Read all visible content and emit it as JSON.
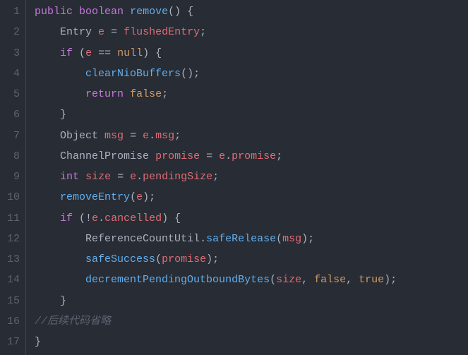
{
  "lines": [
    {
      "n": "1",
      "tokens": [
        {
          "t": "public",
          "c": "kw"
        },
        {
          "t": " ",
          "c": "plain"
        },
        {
          "t": "boolean",
          "c": "type"
        },
        {
          "t": " ",
          "c": "plain"
        },
        {
          "t": "remove",
          "c": "fn"
        },
        {
          "t": "() {",
          "c": "punct"
        }
      ]
    },
    {
      "n": "2",
      "tokens": [
        {
          "t": "    ",
          "c": "plain"
        },
        {
          "t": "Entry ",
          "c": "plain"
        },
        {
          "t": "e",
          "c": "id"
        },
        {
          "t": " = ",
          "c": "plain"
        },
        {
          "t": "flushedEntry",
          "c": "id"
        },
        {
          "t": ";",
          "c": "punct"
        }
      ]
    },
    {
      "n": "3",
      "tokens": [
        {
          "t": "    ",
          "c": "plain"
        },
        {
          "t": "if",
          "c": "kw"
        },
        {
          "t": " (",
          "c": "punct"
        },
        {
          "t": "e",
          "c": "id"
        },
        {
          "t": " == ",
          "c": "plain"
        },
        {
          "t": "null",
          "c": "lit"
        },
        {
          "t": ") {",
          "c": "punct"
        }
      ]
    },
    {
      "n": "4",
      "tokens": [
        {
          "t": "        ",
          "c": "plain"
        },
        {
          "t": "clearNioBuffers",
          "c": "fn"
        },
        {
          "t": "();",
          "c": "punct"
        }
      ]
    },
    {
      "n": "5",
      "tokens": [
        {
          "t": "        ",
          "c": "plain"
        },
        {
          "t": "return",
          "c": "kw"
        },
        {
          "t": " ",
          "c": "plain"
        },
        {
          "t": "false",
          "c": "bool"
        },
        {
          "t": ";",
          "c": "punct"
        }
      ]
    },
    {
      "n": "6",
      "tokens": [
        {
          "t": "    }",
          "c": "punct"
        }
      ]
    },
    {
      "n": "7",
      "tokens": [
        {
          "t": "    ",
          "c": "plain"
        },
        {
          "t": "Object ",
          "c": "plain"
        },
        {
          "t": "msg",
          "c": "id"
        },
        {
          "t": " = ",
          "c": "plain"
        },
        {
          "t": "e",
          "c": "id"
        },
        {
          "t": ".",
          "c": "punct"
        },
        {
          "t": "msg",
          "c": "id"
        },
        {
          "t": ";",
          "c": "punct"
        }
      ]
    },
    {
      "n": "8",
      "tokens": [
        {
          "t": "    ",
          "c": "plain"
        },
        {
          "t": "ChannelPromise ",
          "c": "plain"
        },
        {
          "t": "promise",
          "c": "id"
        },
        {
          "t": " = ",
          "c": "plain"
        },
        {
          "t": "e",
          "c": "id"
        },
        {
          "t": ".",
          "c": "punct"
        },
        {
          "t": "promise",
          "c": "id"
        },
        {
          "t": ";",
          "c": "punct"
        }
      ]
    },
    {
      "n": "9",
      "tokens": [
        {
          "t": "    ",
          "c": "plain"
        },
        {
          "t": "int",
          "c": "type"
        },
        {
          "t": " ",
          "c": "plain"
        },
        {
          "t": "size",
          "c": "id"
        },
        {
          "t": " = ",
          "c": "plain"
        },
        {
          "t": "e",
          "c": "id"
        },
        {
          "t": ".",
          "c": "punct"
        },
        {
          "t": "pendingSize",
          "c": "id"
        },
        {
          "t": ";",
          "c": "punct"
        }
      ]
    },
    {
      "n": "10",
      "tokens": [
        {
          "t": "    ",
          "c": "plain"
        },
        {
          "t": "removeEntry",
          "c": "fn"
        },
        {
          "t": "(",
          "c": "punct"
        },
        {
          "t": "e",
          "c": "id"
        },
        {
          "t": ");",
          "c": "punct"
        }
      ]
    },
    {
      "n": "11",
      "tokens": [
        {
          "t": "    ",
          "c": "plain"
        },
        {
          "t": "if",
          "c": "kw"
        },
        {
          "t": " (!",
          "c": "punct"
        },
        {
          "t": "e",
          "c": "id"
        },
        {
          "t": ".",
          "c": "punct"
        },
        {
          "t": "cancelled",
          "c": "id"
        },
        {
          "t": ") {",
          "c": "punct"
        }
      ]
    },
    {
      "n": "12",
      "tokens": [
        {
          "t": "        ",
          "c": "plain"
        },
        {
          "t": "ReferenceCountUtil",
          "c": "plain"
        },
        {
          "t": ".",
          "c": "punct"
        },
        {
          "t": "safeRelease",
          "c": "fn"
        },
        {
          "t": "(",
          "c": "punct"
        },
        {
          "t": "msg",
          "c": "id"
        },
        {
          "t": ");",
          "c": "punct"
        }
      ]
    },
    {
      "n": "13",
      "tokens": [
        {
          "t": "        ",
          "c": "plain"
        },
        {
          "t": "safeSuccess",
          "c": "fn"
        },
        {
          "t": "(",
          "c": "punct"
        },
        {
          "t": "promise",
          "c": "id"
        },
        {
          "t": ");",
          "c": "punct"
        }
      ]
    },
    {
      "n": "14",
      "tokens": [
        {
          "t": "        ",
          "c": "plain"
        },
        {
          "t": "decrementPendingOutboundBytes",
          "c": "fn"
        },
        {
          "t": "(",
          "c": "punct"
        },
        {
          "t": "size",
          "c": "id"
        },
        {
          "t": ", ",
          "c": "punct"
        },
        {
          "t": "false",
          "c": "bool"
        },
        {
          "t": ", ",
          "c": "punct"
        },
        {
          "t": "true",
          "c": "bool"
        },
        {
          "t": ");",
          "c": "punct"
        }
      ]
    },
    {
      "n": "15",
      "tokens": [
        {
          "t": "    }",
          "c": "punct"
        }
      ]
    },
    {
      "n": "16",
      "tokens": [
        {
          "t": "//后续代码省略",
          "c": "comment"
        }
      ]
    },
    {
      "n": "17",
      "tokens": [
        {
          "t": "}",
          "c": "punct"
        }
      ]
    }
  ]
}
